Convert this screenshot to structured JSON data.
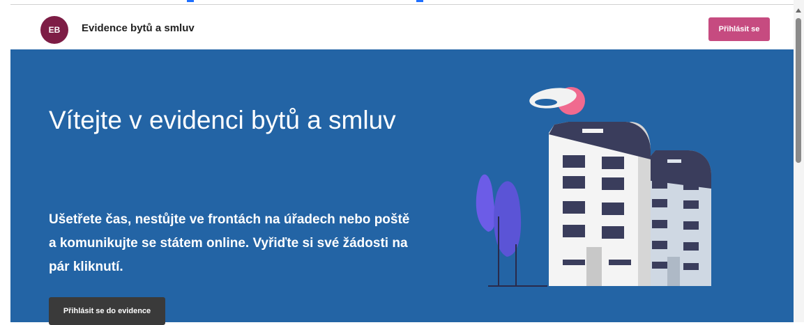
{
  "header": {
    "avatar_initials": "EB",
    "title": "Evidence bytů a smluv",
    "login_label": "Přihlásit se"
  },
  "hero": {
    "title": "Vítejte v evidenci bytů a smluv",
    "description": "Ušetřete čas, nestůjte ve frontách na úřadech nebo poště a komunikujte se státem online. Vyřiďte si své žádosti na pár kliknutí.",
    "cta_label": "Přihlásit se do evidence"
  },
  "colors": {
    "hero_background": "#2364a5",
    "avatar": "#7d1d45",
    "login_button": "#c64b80",
    "cta_button": "#3a3a3a",
    "top_marker": "#1e6fff"
  },
  "icons": {
    "illustration": "apartment-buildings-illustration",
    "scroll_up": "scroll-up-arrow-icon"
  }
}
